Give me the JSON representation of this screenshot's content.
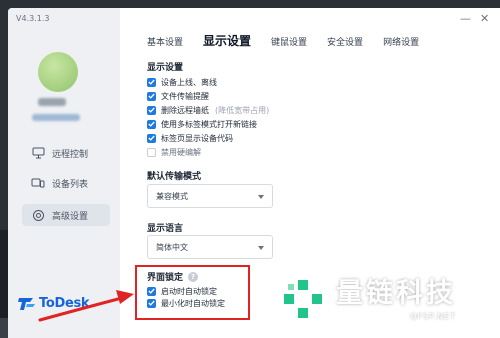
{
  "app": {
    "version": "V4.3.1.3",
    "logo_text": "ToDesk"
  },
  "window_controls": {
    "minimize": "—",
    "close": "✕"
  },
  "sidebar": {
    "items": [
      {
        "label": "远程控制",
        "icon": "monitor-icon",
        "active": false
      },
      {
        "label": "设备列表",
        "icon": "devices-icon",
        "active": false
      },
      {
        "label": "高级设置",
        "icon": "settings-icon",
        "active": true
      }
    ]
  },
  "tabs": [
    {
      "label": "基本设置",
      "active": false
    },
    {
      "label": "显示设置",
      "active": true
    },
    {
      "label": "键鼠设置",
      "active": false
    },
    {
      "label": "安全设置",
      "active": false
    },
    {
      "label": "网络设置",
      "active": false
    }
  ],
  "display_settings": {
    "title": "显示设置",
    "options": [
      {
        "label": "设备上线、离线",
        "checked": true
      },
      {
        "label": "文件传输提醒",
        "checked": true
      },
      {
        "label": "删除远程墙纸",
        "hint": "(降低宽带占用)",
        "checked": true
      },
      {
        "label": "使用多标签模式打开新链接",
        "checked": true
      },
      {
        "label": "标签页显示设备代码",
        "checked": true
      },
      {
        "label": "禁用硬编解",
        "checked": false
      }
    ]
  },
  "transfer_mode": {
    "title": "默认传输模式",
    "value": "兼容模式"
  },
  "display_language": {
    "title": "显示语言",
    "value": "简体中文"
  },
  "interface_lock": {
    "title": "界面锁定",
    "help_icon": "?",
    "options": [
      {
        "label": "启动时自动锁定",
        "checked": true
      },
      {
        "label": "最小化时自动锁定",
        "checked": true
      }
    ]
  },
  "watermark": {
    "name": "量链科技",
    "url": "QFSP.NET"
  },
  "colors": {
    "accent": "#1f7ae0",
    "highlight": "#e02424",
    "brand": "#1565d8",
    "watermark_green": "#22c48a"
  }
}
